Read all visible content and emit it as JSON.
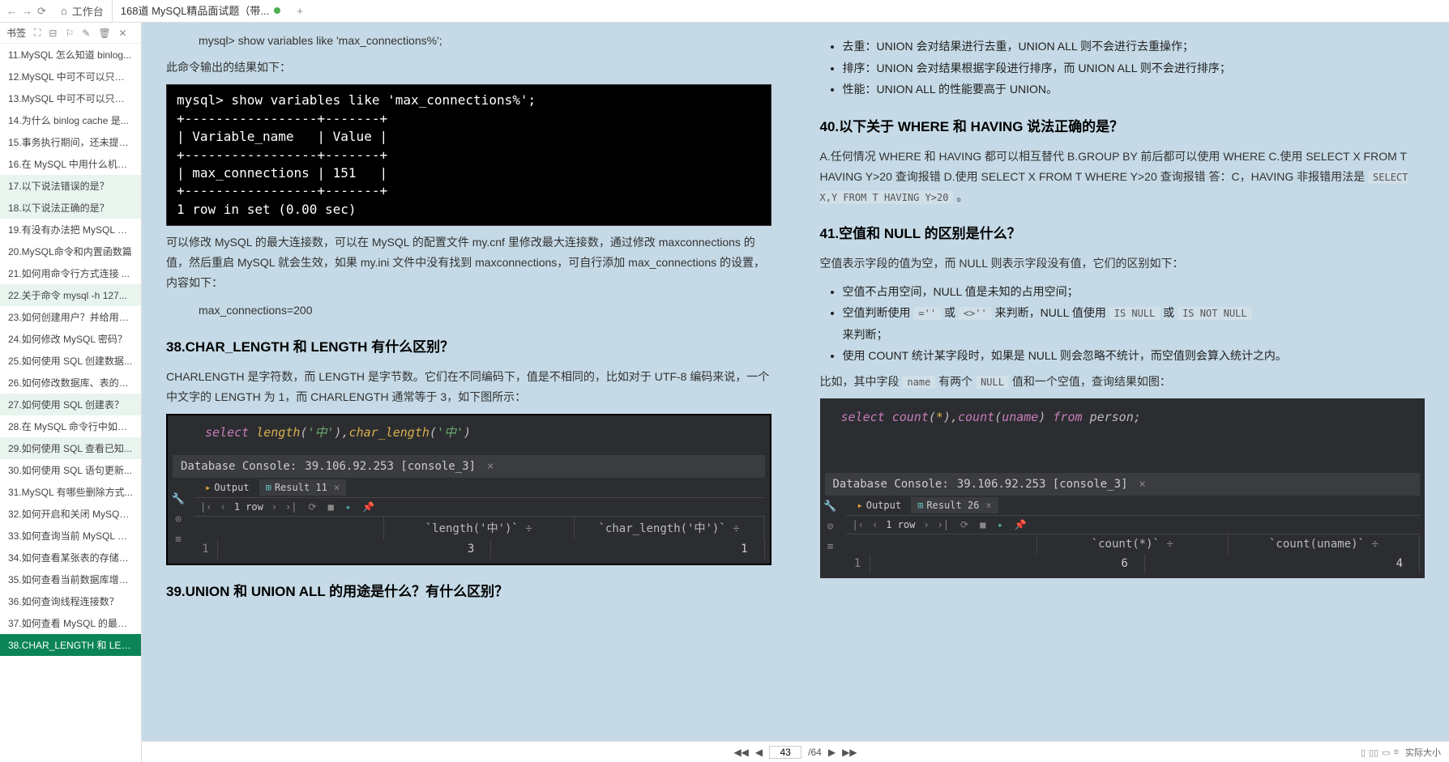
{
  "topbar": {
    "home": "工作台",
    "doc_tab": "168道 MySQL精品面试题（带..."
  },
  "sidebar": {
    "label": "书签",
    "items": [
      "11.MySQL 怎么知道 binlog...",
      "12.MySQL 中可不可以只要 ...",
      "13.MySQL 中可不可以只要 ...",
      "14.为什么 binlog cache 是...",
      "15.事务执行期间，还未提交...",
      "16.在 MySQL 中用什么机制...",
      "17.以下说法错误的是？",
      "18.以下说法正确的是？",
      "19.有没有办法把 MySQL 的...",
      "20.MySQL命令和内置函数篇",
      "21.如何用命令行方式连接 ...",
      "22.关于命令 mysql -h 127...",
      "23.如何创建用户？并给用户...",
      "24.如何修改 MySQL 密码？",
      "25.如何使用 SQL 创建数据...",
      "26.如何修改数据库、表的编...",
      "27.如何使用 SQL 创建表？",
      "28.在 MySQL 命令行中如何...",
      "29.如何使用 SQL 查看已知...",
      "30.如何使用 SQL 语句更新...",
      "31.MySQL 有哪些删除方式...",
      "32.如何开启和关闭 MySQL...",
      "33.如何查询当前 MySQL 安...",
      "34.如何查看某张表的存储引...",
      "35.如何查看当前数据库增删...",
      "36.如何查询线程连接数？",
      "37.如何查看 MySQL 的最大...",
      "38.CHAR_LENGTH 和 LEN..."
    ]
  },
  "recent_idx": [
    6,
    7,
    11,
    16,
    18
  ],
  "active_idx": 27,
  "left": {
    "cmd1": "mysql> show variables like 'max_connections%';",
    "note1": "此命令输出的结果如下：",
    "terminal": "mysql> show variables like 'max_connections%';\n+-----------------+-------+\n| Variable_name   | Value |\n+-----------------+-------+\n| max_connections | 151   |\n+-----------------+-------+\n1 row in set (0.00 sec)",
    "para2": "可以修改 MySQL 的最大连接数，可以在 MySQL 的配置文件 my.cnf 里修改最大连接数，通过修改 maxconnections 的值，然后重启 MySQL 就会生效，如果 my.ini 文件中没有找到 maxconnections，可自行添加 max_connections 的设置，内容如下：",
    "cfg": "max_connections=200",
    "h38": "38.CHAR_LENGTH 和 LENGTH 有什么区别？",
    "p38": "CHARLENGTH 是字符数，而 LENGTH 是字节数。它们在不同编码下，值是不相同的，比如对于 UTF-8 编码来说，一个中文字的 LENGTH 为 1，而 CHARLENGTH 通常等于 3，如下图所示：",
    "console_label": "Database Console:",
    "console_host": "39.106.92.253 [console_3]",
    "tab_output": "Output",
    "tab_result": "Result 11",
    "rows_label": "1 row",
    "col1": "`length('中')`",
    "col2": "`char_length('中')`",
    "val1": "3",
    "val2": "1",
    "rownum": "1",
    "h39": "39.UNION 和 UNION ALL 的用途是什么？有什么区别？"
  },
  "right": {
    "b1": "去重：UNION 会对结果进行去重，UNION ALL 则不会进行去重操作；",
    "b2": "排序：UNION 会对结果根据字段进行排序，而 UNION ALL 则不会进行排序；",
    "b3": "性能：UNION ALL 的性能要高于 UNION。",
    "h40": "40.以下关于 WHERE 和 HAVING 说法正确的是？",
    "p40": "A.任何情况 WHERE 和 HAVING 都可以相互替代  B.GROUP BY 前后都可以使用 WHERE C.使用 SELECT X FROM T HAVING Y>20 查询报错  D.使用 SELECT X FROM T WHERE Y>20 查询报错  答：C，HAVING 非报错用法是 ",
    "code40": "SELECT X,Y FROM T HAVING Y>20",
    "p40end": " 。",
    "h41": "41.空值和 NULL 的区别是什么？",
    "p41a": "空值表示字段的值为空，而 NULL 则表示字段没有值，它们的区别如下：",
    "b41_1": "空值不占用空间，NULL 值是未知的占用空间；",
    "b41_2a": "空值判断使用 ",
    "eq": "=''",
    "b41_2b": " 或 ",
    "ne": "<>''",
    "b41_2c": " 来判断，NULL 值使用 ",
    "isnull": "IS NULL",
    "b41_2d": " 或 ",
    "isnotnull": "IS NOT NULL",
    "b41_2e": "来判断；",
    "b41_3": "使用 COUNT 统计某字段时，如果是 NULL 则会忽略不统计，而空值则会算入统计之内。",
    "p41b_a": "比如，其中字段 ",
    "name": "name",
    "p41b_b": " 有两个 ",
    "null": "NULL",
    "p41b_c": " 值和一个空值，查询结果如图：",
    "console2_label": "Database Console:",
    "console2_host": "39.106.92.253 [console_3]",
    "tab2_output": "Output",
    "tab2_result": "Result 26",
    "rows2_label": "1 row",
    "rcol1": "`count(*)`",
    "rcol2": "`count(uname)`",
    "rval1": "6",
    "rval2": "4",
    "rrownum": "1"
  },
  "pager": {
    "page": "43",
    "total": "/64"
  },
  "status": {
    "label": "实际大小"
  }
}
